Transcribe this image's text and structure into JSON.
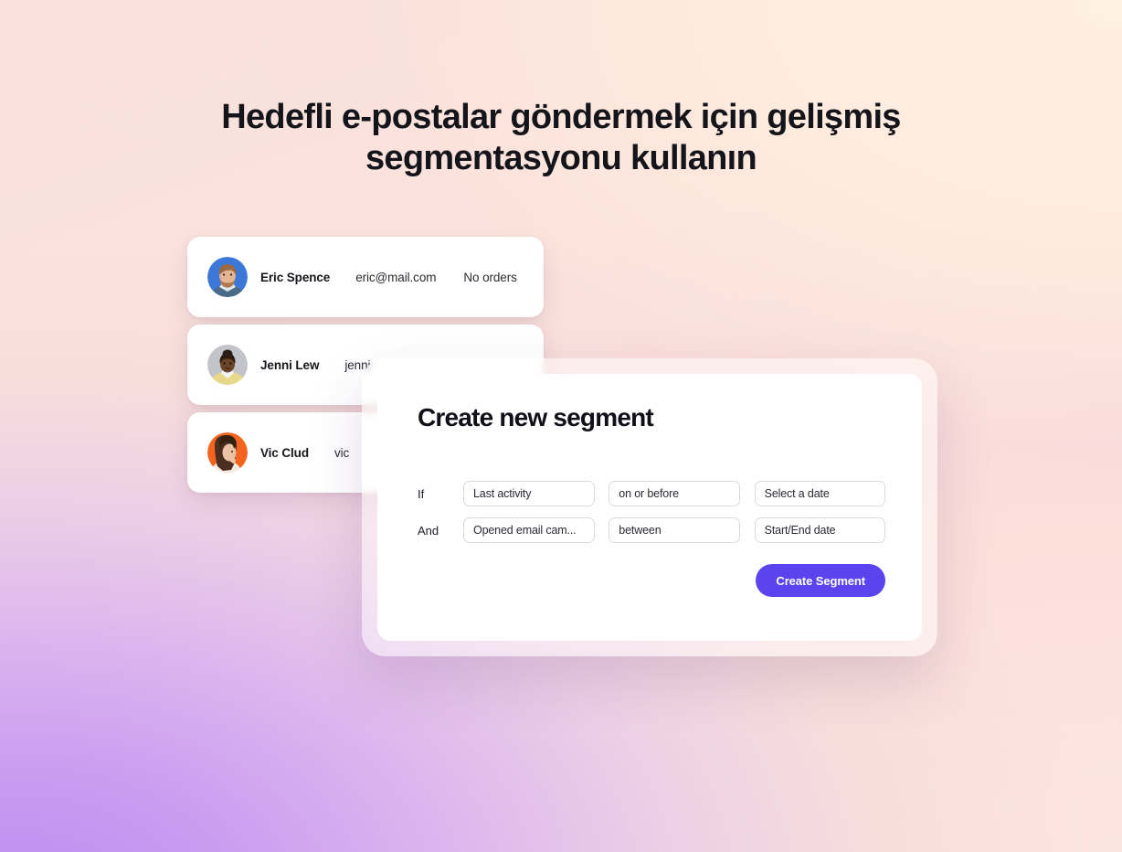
{
  "background": {
    "gradient_top_left": "#fae0dc",
    "gradient_top_right": "#ffeee3",
    "gradient_bottom_left": "#c79cf0",
    "gradient_bottom_right": "#fde4de"
  },
  "headline": "Hedefli e-postalar göndermek için gelişmiş segmentasyonu kullanın",
  "contacts": [
    {
      "name": "Eric Spence",
      "email": "eric@mail.com",
      "orders": "No orders",
      "avatar_name": "avatar-eric-spence",
      "avatar_bg": "#3b78d8"
    },
    {
      "name": "Jenni Lew",
      "email": "jenni",
      "orders": "",
      "avatar_name": "avatar-jenni-lew",
      "avatar_bg": "#c2c4c9"
    },
    {
      "name": "Vic Clud",
      "email": "vic",
      "orders": "",
      "avatar_name": "avatar-vic-clud",
      "avatar_bg": "#f4641e"
    }
  ],
  "modal": {
    "title": "Create new segment",
    "rows": [
      {
        "label": "If",
        "field_attribute": "Last activity",
        "field_operator": "on or before",
        "field_value": "Select a date"
      },
      {
        "label": "And",
        "field_attribute": "Opened email cam...",
        "field_operator": "between",
        "field_value": "Start/End date"
      }
    ],
    "submit_label": "Create Segment",
    "accent_color": "#5b43ee"
  }
}
